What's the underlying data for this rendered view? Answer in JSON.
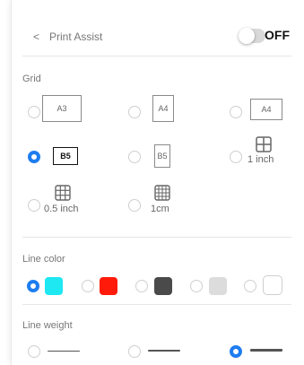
{
  "header": {
    "back": "<",
    "title": "Print Assist",
    "toggle_label": "OFF"
  },
  "grid": {
    "title": "Grid",
    "options": [
      {
        "label": "A3",
        "selected": false
      },
      {
        "label": "A4",
        "selected": false
      },
      {
        "label": "A4",
        "selected": false
      },
      {
        "label": "B5",
        "selected": true
      },
      {
        "label": "B5",
        "selected": false
      },
      {
        "label": "1 inch",
        "selected": false
      },
      {
        "label": "0.5 inch",
        "selected": false
      },
      {
        "label": "1cm",
        "selected": false
      }
    ]
  },
  "line_color": {
    "title": "Line color",
    "colors": [
      "#1ee8f2",
      "#ff1a0a",
      "#4a4a4a",
      "#dcdcdc",
      "#ffffff"
    ]
  },
  "line_weight": {
    "title": "Line weight"
  },
  "accent": "#1e7df0"
}
